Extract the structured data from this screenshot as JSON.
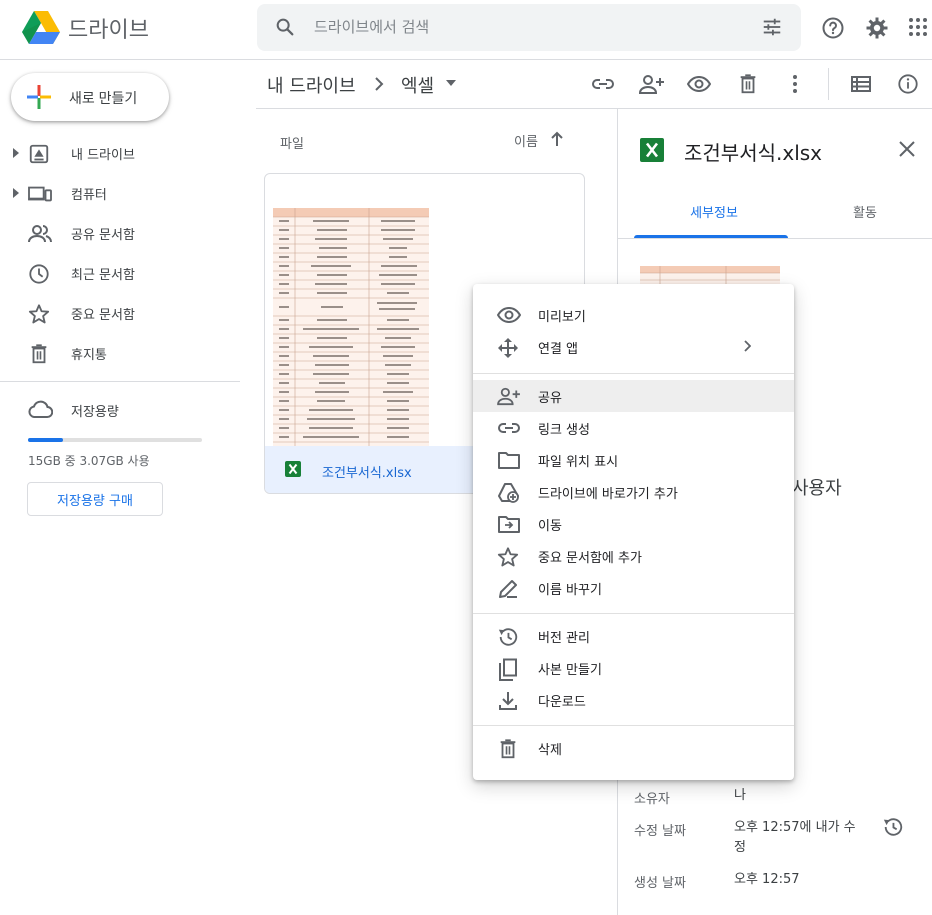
{
  "app": {
    "title": "드라이브"
  },
  "search": {
    "placeholder": "드라이브에서 검색"
  },
  "sidebar": {
    "new_label": "새로 만들기",
    "items": [
      {
        "label": "내 드라이브"
      },
      {
        "label": "컴퓨터"
      },
      {
        "label": "공유 문서함"
      },
      {
        "label": "최근 문서함"
      },
      {
        "label": "중요 문서함"
      },
      {
        "label": "휴지통"
      }
    ],
    "storage": {
      "title": "저장용량",
      "usage_text": "15GB 중 3.07GB 사용",
      "used_fraction": 0.2,
      "buy_label": "저장용량 구매"
    }
  },
  "breadcrumb": {
    "root": "내 드라이브",
    "current": "엑셀"
  },
  "main": {
    "files_heading": "파일",
    "sort_label": "이름",
    "file": {
      "name": "조건부서식.xlsx"
    }
  },
  "details_panel": {
    "title": "조건부서식.xlsx",
    "tabs": [
      {
        "label": "세부정보"
      },
      {
        "label": "활동"
      }
    ],
    "users_label": "사용자",
    "meta": {
      "owner_label": "소유자",
      "owner_value": "나",
      "modified_label": "수정 날짜",
      "modified_value_1": "오후 12:57에 내가 수",
      "modified_value_2": "정",
      "created_label": "생성 날짜",
      "created_value": "오후 12:57"
    }
  },
  "context_menu": {
    "items": [
      {
        "label": "미리보기",
        "icon": "eye-icon"
      },
      {
        "label": "연결 앱",
        "icon": "move-arrows-icon"
      },
      {
        "label": "공유",
        "icon": "person-add-icon"
      },
      {
        "label": "링크 생성",
        "icon": "link-icon"
      },
      {
        "label": "파일 위치 표시",
        "icon": "folder-icon"
      },
      {
        "label": "드라이브에 바로가기 추가",
        "icon": "drive-shortcut-icon"
      },
      {
        "label": "이동",
        "icon": "folder-move-icon"
      },
      {
        "label": "중요 문서함에 추가",
        "icon": "star-icon"
      },
      {
        "label": "이름 바꾸기",
        "icon": "pencil-icon"
      },
      {
        "label": "버전 관리",
        "icon": "history-icon"
      },
      {
        "label": "사본 만들기",
        "icon": "copy-icon"
      },
      {
        "label": "다운로드",
        "icon": "download-icon"
      },
      {
        "label": "삭제",
        "icon": "trash-icon"
      }
    ]
  },
  "colors": {
    "accent": "#1a73e8",
    "excel_green": "#188038",
    "highlight": "#eeeeee"
  }
}
